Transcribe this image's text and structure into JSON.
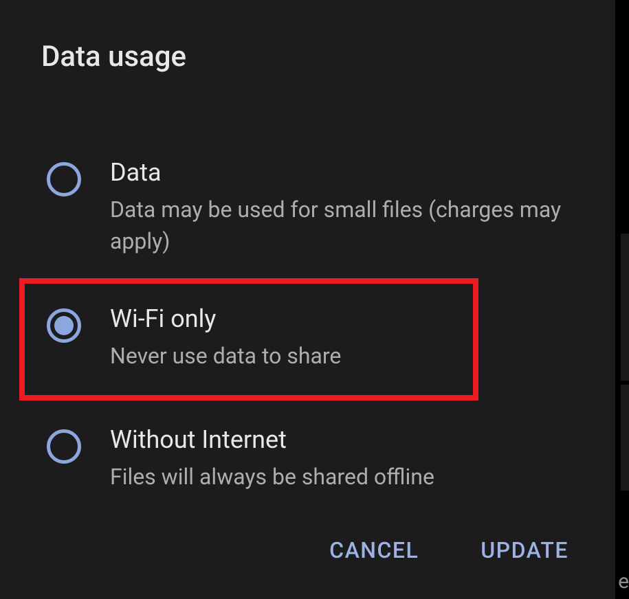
{
  "dialog": {
    "title": "Data usage",
    "options": [
      {
        "title": "Data",
        "subtitle": "Data may be used for small files (charges may apply)",
        "selected": false,
        "highlighted": false
      },
      {
        "title": "Wi-Fi only",
        "subtitle": "Never use data to share",
        "selected": true,
        "highlighted": true
      },
      {
        "title": "Without Internet",
        "subtitle": "Files will always be shared offline",
        "selected": false,
        "highlighted": false
      }
    ],
    "actions": {
      "cancel": "CANCEL",
      "update": "UPDATE"
    }
  },
  "edge_char": "e"
}
